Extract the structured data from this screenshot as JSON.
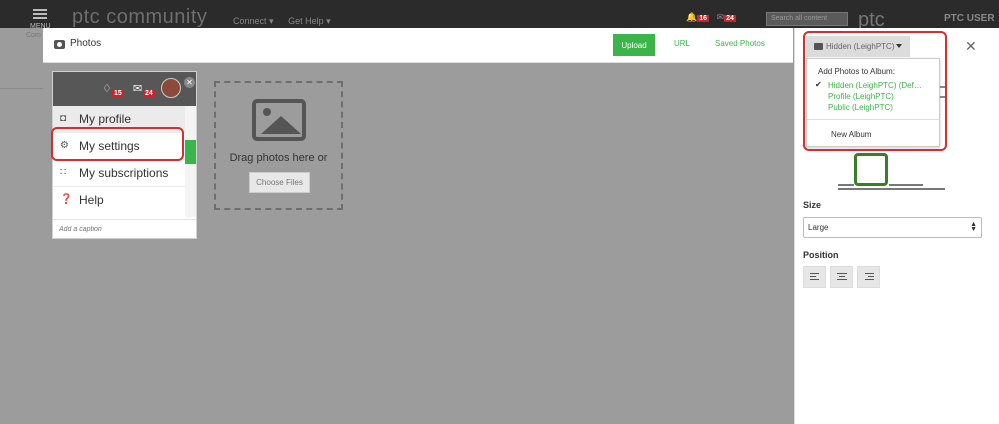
{
  "site": {
    "logo": "ptc community",
    "menu_label": "MENU",
    "bg_left_text": "Com",
    "nav": [
      "Connect ▾",
      "Get Help ▾"
    ],
    "notif_count": "16",
    "mail_count": "24",
    "search_placeholder": "Search all content",
    "ptc_logo": "ptc",
    "ptc_user": "PTC USER"
  },
  "modal": {
    "title": "Photos",
    "tabs": {
      "upload": "Upload",
      "url": "URL",
      "saved": "Saved Photos"
    },
    "thumbnail": {
      "notif_count": "15",
      "mail_count": "24",
      "menu": [
        {
          "label": "My profile",
          "icon": "user-icon"
        },
        {
          "label": "My settings",
          "icon": "gear-icon"
        },
        {
          "label": "My subscriptions",
          "icon": "rss-icon"
        },
        {
          "label": "Help",
          "icon": "help-icon"
        }
      ],
      "caption_placeholder": "Add a caption"
    },
    "dropzone": {
      "text": "Drag photos here or",
      "button": "Choose Files"
    }
  },
  "panel": {
    "album_button": "Hidden (LeighPTC)",
    "dropdown": {
      "header": "Add Photos to Album:",
      "items": [
        "Hidden (LeighPTC) (Def…",
        "Profile (LeighPTC)",
        "Public (LeighPTC)"
      ],
      "new_album": "New Album"
    },
    "size_label": "Size",
    "size_value": "Large",
    "position_label": "Position"
  },
  "colors": {
    "accent_green": "#3bb54a",
    "highlight_red": "#d32f2f",
    "badge_red": "#c1272d"
  }
}
